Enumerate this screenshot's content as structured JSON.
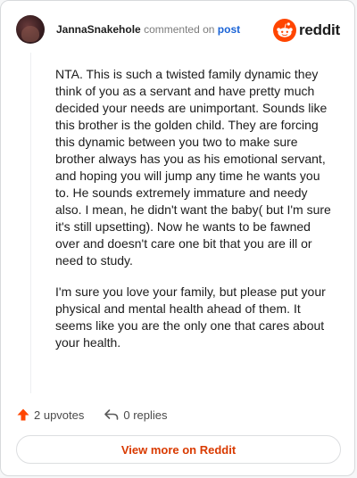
{
  "comment": {
    "username": "JannaSnakehole",
    "commented_on": "commented on",
    "post_link": "post",
    "paragraphs": [
      "NTA. This is such a twisted family dynamic they think of you as a servant and have pretty much decided your needs are unimportant. Sounds like this brother is the golden child. They are forcing this dynamic between you two to make sure brother always has you as his emotional servant, and hoping you will jump any time he wants you to. He sounds extremely immature and needy also. I mean, he didn't want the baby( but I'm sure it's still upsetting). Now he wants to be fawned over and doesn't care one bit that you are ill or need to study.",
      "I'm sure you love your family, but please put your physical and mental health ahead of them. It seems like you are the only one that cares about your health."
    ]
  },
  "brand": {
    "word": "reddit",
    "icon": "reddit-logo-icon",
    "color": "#ff4500"
  },
  "actions": {
    "upvotes_label": "2 upvotes",
    "replies_label": "0 replies",
    "upvote_icon": "upvote-arrow-icon",
    "reply_icon": "reply-arrow-icon",
    "upvote_color": "#ff4500"
  },
  "footer": {
    "view_more_label": "View more on Reddit",
    "accent": "#d93a00"
  }
}
